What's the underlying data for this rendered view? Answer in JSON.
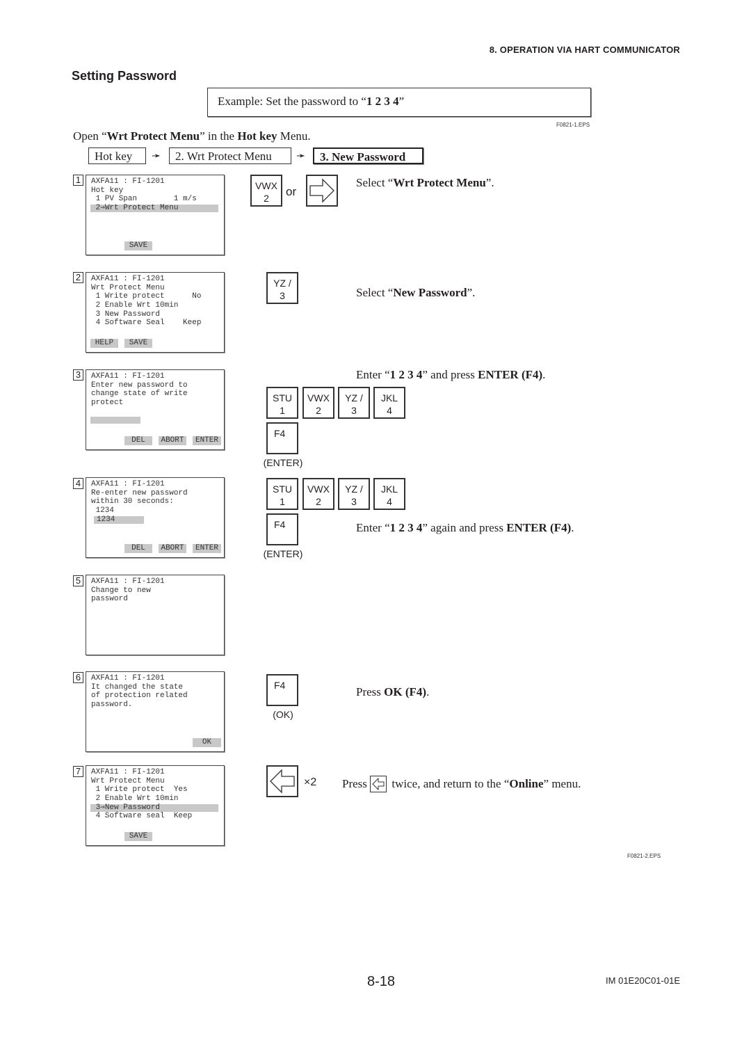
{
  "header": {
    "running_head": "8.  OPERATION VIA HART COMMUNICATOR",
    "section_title": "Setting Password"
  },
  "example": {
    "prefix": "Example: Set the password to “",
    "value": "1 2 3 4",
    "suffix": "”",
    "figure_label": "F0821-1.EPS"
  },
  "intro": {
    "p1": "Open “",
    "b1": "Wrt Protect Menu",
    "p2": "” in the ",
    "b2": "Hot key",
    "p3": " Menu."
  },
  "breadcrumb": {
    "items": [
      "Hot key",
      "2.  Wrt Protect Menu",
      "3.  New Password"
    ],
    "arrow": "➛"
  },
  "steps": [
    {
      "num": "1",
      "screen": {
        "lines": [
          "AXFA11 : FI-1201",
          "Hot key",
          " 1 PV Span        1 m/s",
          " 2⇒Wrt Protect Menu"
        ],
        "softkeys": [
          "SAVE"
        ]
      },
      "keys": [
        "VWX",
        "2"
      ],
      "or": "or",
      "instruction": {
        "p1": "Select “",
        "b1": "Wrt Protect Menu",
        "p2": "”."
      }
    },
    {
      "num": "2",
      "screen": {
        "lines": [
          "AXFA11 : FI-1201",
          "Wrt Protect Menu",
          " 1 Write protect      No",
          " 2 Enable Wrt 10min",
          " 3 New Password",
          " 4 Software Seal    Keep"
        ],
        "softkeys": [
          "HELP",
          "SAVE"
        ]
      },
      "keys": [
        "YZ /",
        "3"
      ],
      "instruction": {
        "p1": "Select “",
        "b1": "New Password",
        "p2": "”."
      }
    },
    {
      "num": "3",
      "screen": {
        "lines": [
          "AXFA11 : FI-1201",
          "Enter new password to",
          "change state of write",
          "protect"
        ],
        "input_value": "",
        "softkeys": [
          "DEL",
          "ABORT",
          "ENTER"
        ]
      },
      "keys": [
        [
          "STU",
          "1"
        ],
        [
          "VWX",
          "2"
        ],
        [
          "YZ /",
          "3"
        ],
        [
          "JKL",
          "4"
        ]
      ],
      "fkey": "F4",
      "fkey_caption": "(ENTER)",
      "instruction": {
        "p1": "Enter “",
        "b1": "1 2 3 4",
        "p2": "” and press ",
        "b2": "ENTER (F4)",
        "p3": "."
      }
    },
    {
      "num": "4",
      "screen": {
        "lines": [
          "AXFA11 : FI-1201",
          "Re-enter new password",
          "within 30 seconds:",
          " 1234"
        ],
        "input_value": "1234",
        "softkeys": [
          "DEL",
          "ABORT",
          "ENTER"
        ]
      },
      "keys": [
        [
          "STU",
          "1"
        ],
        [
          "VWX",
          "2"
        ],
        [
          "YZ /",
          "3"
        ],
        [
          "JKL",
          "4"
        ]
      ],
      "fkey": "F4",
      "fkey_caption": "(ENTER)",
      "instruction": {
        "p1": "Enter “",
        "b1": "1 2 3 4",
        "p2": "”  again and press ",
        "b2": "ENTER (F4)",
        "p3": "."
      }
    },
    {
      "num": "5",
      "screen": {
        "lines": [
          "AXFA11 : FI-1201",
          "Change to new",
          "password"
        ]
      }
    },
    {
      "num": "6",
      "screen": {
        "lines": [
          "AXFA11 : FI-1201",
          "It changed the state",
          "of protection related",
          "password."
        ],
        "softkeys": [
          "OK"
        ]
      },
      "fkey": "F4",
      "fkey_caption": "(OK)",
      "instruction": {
        "p1": "Press ",
        "b1": "OK (F4)",
        "p2": "."
      }
    },
    {
      "num": "7",
      "screen": {
        "lines": [
          "AXFA11 : FI-1201",
          "Wrt Protect Menu",
          " 1 Write protect  Yes",
          " 2 Enable Wrt 10min",
          " 3⇒New Password",
          " 4 Software seal  Keep"
        ],
        "softkeys": [
          "SAVE"
        ]
      },
      "times": "×2",
      "instruction": {
        "p1": "Press ",
        "p2": " twice, and return to the “",
        "b1": "Online",
        "p3": "” menu."
      }
    }
  ],
  "figure_label_2": "F0821-2.EPS",
  "footer": {
    "page_number": "8-18",
    "doc_id": "IM 01E20C01-01E"
  },
  "icons": {
    "right_arrow_key": "right-arrow-icon",
    "left_arrow_key": "left-arrow-icon"
  }
}
